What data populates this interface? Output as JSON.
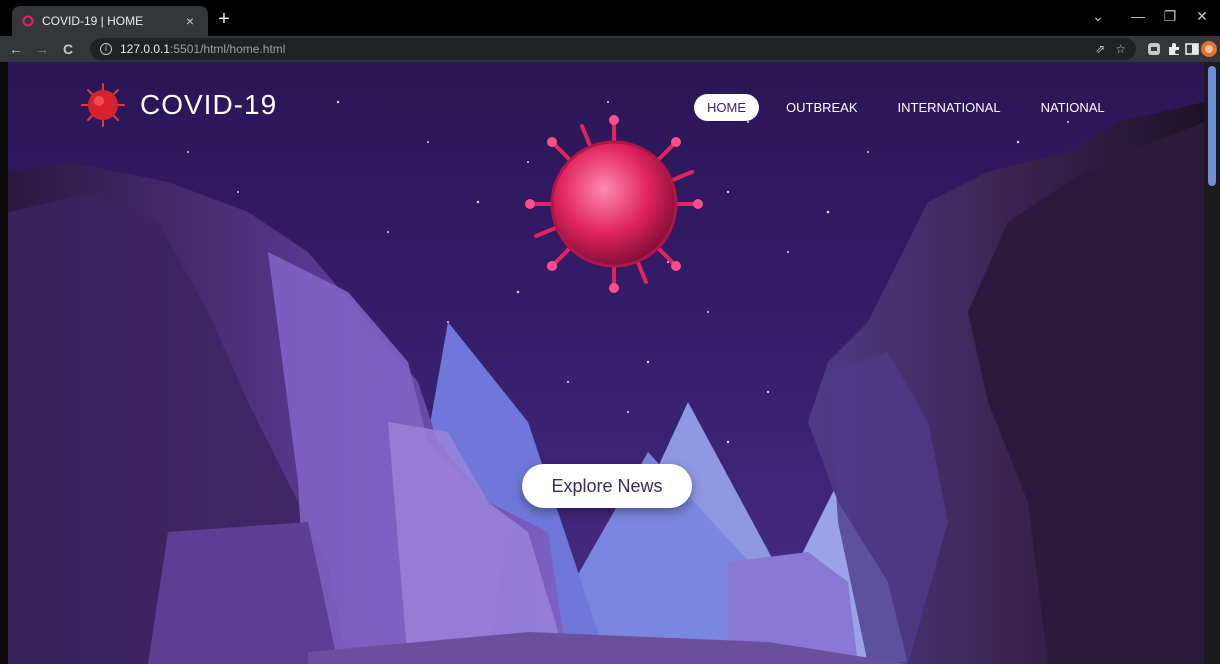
{
  "browser": {
    "tab_title": "COVID-19 | HOME",
    "tab_close": "×",
    "new_tab": "+",
    "url_host": "127.0.0.1",
    "url_path": ":5501/html/home.html",
    "window_controls": {
      "minimize": "—",
      "restore": "❐",
      "close": "✕",
      "dropdown": "⌄"
    },
    "nav": {
      "back": "←",
      "forward": "→",
      "reload": "C"
    },
    "omnibox_actions": {
      "share": "⇗",
      "bookmark": "☆"
    }
  },
  "site": {
    "brand_name": "COVID-19",
    "nav_items": [
      {
        "label": "HOME",
        "active": true
      },
      {
        "label": "OUTBREAK",
        "active": false
      },
      {
        "label": "INTERNATIONAL",
        "active": false
      },
      {
        "label": "NATIONAL",
        "active": false
      }
    ],
    "cta_label": "Explore News"
  },
  "colors": {
    "sky_top": "#2a1656",
    "sky_bottom": "#4a2f86",
    "virus": "#e0245e",
    "cliff_dark": "#2c1a3e",
    "cliff_purple": "#6e4db2",
    "mountain_blue": "#7b86e0"
  }
}
